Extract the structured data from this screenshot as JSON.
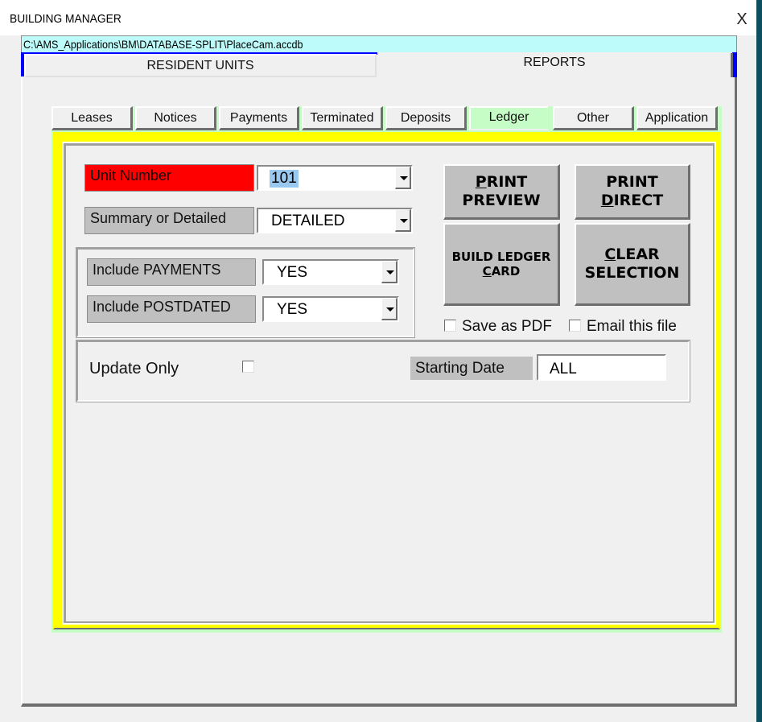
{
  "window": {
    "title": "BUILDING MANAGER",
    "close_glyph": "X",
    "db_path": "C:\\AMS_Applications\\BM\\DATABASE-SPLIT\\PlaceCam.accdb"
  },
  "main_tabs": [
    {
      "label": "RESIDENT UNITS",
      "active": false
    },
    {
      "label": "REPORTS",
      "active": true
    }
  ],
  "report_tabs": [
    {
      "label": "Leases",
      "active": false
    },
    {
      "label": "Notices",
      "active": false
    },
    {
      "label": "Payments",
      "active": false
    },
    {
      "label": "Terminated",
      "active": false
    },
    {
      "label": "Deposits",
      "active": false
    },
    {
      "label": "Ledger",
      "active": true
    },
    {
      "label": "Other",
      "active": false
    },
    {
      "label": "Application",
      "active": false
    }
  ],
  "form": {
    "unit_number": {
      "label": "Unit Number",
      "value": "101"
    },
    "summary_detailed": {
      "label": "Summary or Detailed",
      "value": "DETAILED"
    },
    "include_payments": {
      "label": "Include PAYMENTS",
      "value": "YES"
    },
    "include_postdated": {
      "label": "Include POSTDATED",
      "value": "YES"
    },
    "update_only": {
      "label": "Update Only",
      "checked": false
    },
    "starting_date": {
      "label": "Starting Date",
      "value": "ALL"
    }
  },
  "buttons": {
    "print_preview": {
      "line1_mnemonic": "P",
      "line1_rest": "RINT",
      "line2": "PREVIEW"
    },
    "print_direct": {
      "line1": "PRINT",
      "line2_mnemonic": "D",
      "line2_rest": "IRECT"
    },
    "build_ledger": {
      "line1": "BUILD LEDGER",
      "line2_mnemonic": "C",
      "line2_rest": "ARD"
    },
    "clear_selection": {
      "line1_mnemonic": "C",
      "line1_rest": "LEAR",
      "line2": "SELECTION"
    }
  },
  "options": {
    "save_pdf": {
      "label": "Save as PDF",
      "checked": false
    },
    "email_file": {
      "label": "Email this file",
      "checked": false
    }
  },
  "colors": {
    "required_label": "#ff0000",
    "panel_frame": "#ffff00",
    "active_tab": "#c6fdc6",
    "path_bar": "#bdfbfb"
  }
}
